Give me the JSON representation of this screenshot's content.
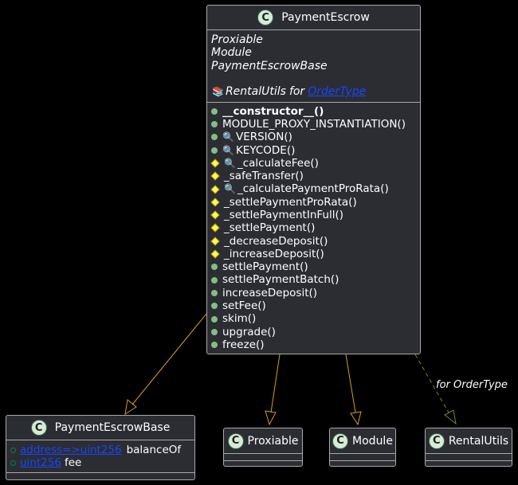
{
  "classes": {
    "payment_escrow": {
      "name": "PaymentEscrow",
      "badge": "C",
      "implements": [
        "Proxiable",
        "Module",
        "PaymentEscrowBase"
      ],
      "using_lib": "RentalUtils",
      "using_for": "for",
      "using_type": "OrderType",
      "library_icon": "book-icon",
      "methods": [
        {
          "label": "__constructor__()",
          "vis": "public",
          "static": false,
          "bold": true
        },
        {
          "label": "MODULE_PROXY_INSTANTIATION()",
          "vis": "public",
          "static": false
        },
        {
          "label": "VERSION()",
          "vis": "public",
          "static": true
        },
        {
          "label": "KEYCODE()",
          "vis": "public",
          "static": true
        },
        {
          "label": "_calculateFee()",
          "vis": "internal",
          "static": true
        },
        {
          "label": "_safeTransfer()",
          "vis": "internal",
          "static": false
        },
        {
          "label": "_calculatePaymentProRata()",
          "vis": "internal",
          "static": true
        },
        {
          "label": "_settlePaymentProRata()",
          "vis": "internal",
          "static": false
        },
        {
          "label": "_settlePaymentInFull()",
          "vis": "internal",
          "static": false
        },
        {
          "label": "_settlePayment()",
          "vis": "internal",
          "static": false
        },
        {
          "label": "_decreaseDeposit()",
          "vis": "internal",
          "static": false
        },
        {
          "label": "_increaseDeposit()",
          "vis": "internal",
          "static": false
        },
        {
          "label": "settlePayment()",
          "vis": "public",
          "static": false
        },
        {
          "label": "settlePaymentBatch()",
          "vis": "public",
          "static": false
        },
        {
          "label": "increaseDeposit()",
          "vis": "public",
          "static": false
        },
        {
          "label": "setFee()",
          "vis": "public",
          "static": false
        },
        {
          "label": "skim()",
          "vis": "public",
          "static": false
        },
        {
          "label": "upgrade()",
          "vis": "public",
          "static": false
        },
        {
          "label": "freeze()",
          "vis": "public",
          "static": false
        }
      ]
    },
    "payment_escrow_base": {
      "name": "PaymentEscrowBase",
      "badge": "C",
      "fields": [
        {
          "type": "address=>uint256",
          "name": "balanceOf"
        },
        {
          "type": "uint256",
          "name": "fee"
        }
      ]
    },
    "proxiable": {
      "name": "Proxiable",
      "badge": "C"
    },
    "module": {
      "name": "Module",
      "badge": "C"
    },
    "rental_utils": {
      "name": "RentalUtils",
      "badge": "C"
    }
  },
  "edges": {
    "using_label": "for OrderType"
  },
  "colors": {
    "class_bg": "#2b2d33",
    "border": "#a9a9a9",
    "inherit_edge": "#d4a017",
    "using_edge": "#6b8e23",
    "public_dot": "#84be84",
    "internal_diamond": "#ffff44",
    "link": "#1a44ff"
  }
}
